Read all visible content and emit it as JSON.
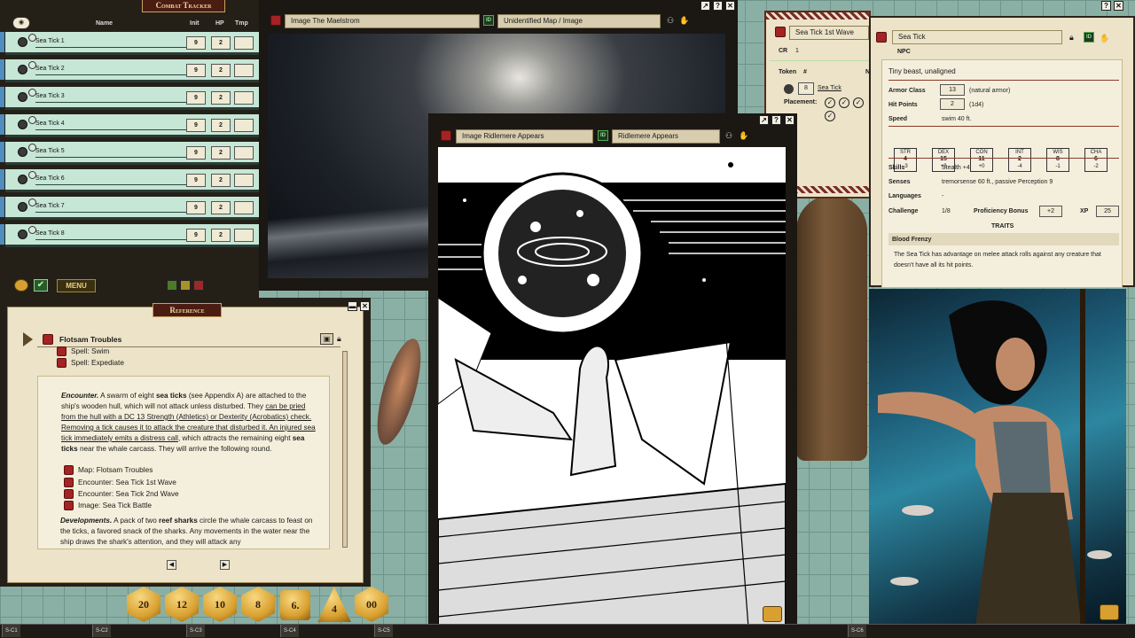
{
  "combat_tracker": {
    "title": "Combat Tracker",
    "col_name": "Name",
    "col_init": "Init",
    "col_hp": "HP",
    "col_tmp": "Tmp",
    "menu_label": "MENU",
    "rows": [
      {
        "name": "Sea Tick 1",
        "init": "9",
        "hp": "2"
      },
      {
        "name": "Sea Tick 2",
        "init": "9",
        "hp": "2"
      },
      {
        "name": "Sea Tick 3",
        "init": "9",
        "hp": "2"
      },
      {
        "name": "Sea Tick 4",
        "init": "9",
        "hp": "2"
      },
      {
        "name": "Sea Tick 5",
        "init": "9",
        "hp": "2"
      },
      {
        "name": "Sea Tick 6",
        "init": "9",
        "hp": "2"
      },
      {
        "name": "Sea Tick 7",
        "init": "9",
        "hp": "2"
      },
      {
        "name": "Sea Tick 8",
        "init": "9",
        "hp": "2"
      }
    ]
  },
  "maelstrom": {
    "title": "Image The Maelstrom",
    "id_label": "ID",
    "id_value": "Unidentified Map / Image"
  },
  "ridlemere": {
    "title": "Image Ridlemere Appears",
    "id_label": "ID",
    "id_value": "Ridlemere Appears"
  },
  "wave1": {
    "title": "Sea Tick 1st Wave",
    "cr_label": "CR",
    "cr_value": "1",
    "token_label": "Token",
    "hash_label": "#",
    "n_label": "N",
    "count": "8",
    "creature": "Sea Tick",
    "placement_label": "Placement:"
  },
  "npc": {
    "name": "Sea Tick",
    "type_label": "NPC",
    "id_label": "ID",
    "subtitle": "Tiny beast, unaligned",
    "ac_label": "Armor Class",
    "ac": "13",
    "ac_note": "(natural armor)",
    "hp_label": "Hit Points",
    "hp": "2",
    "hp_note": "(1d4)",
    "speed_label": "Speed",
    "speed": "swim 40 ft.",
    "abilities": [
      {
        "name": "STR",
        "score": "4",
        "mod": "-3"
      },
      {
        "name": "DEX",
        "score": "15",
        "mod": "+2"
      },
      {
        "name": "CON",
        "score": "11",
        "mod": "+0"
      },
      {
        "name": "INT",
        "score": "2",
        "mod": "-4"
      },
      {
        "name": "WIS",
        "score": "8",
        "mod": "-1"
      },
      {
        "name": "CHA",
        "score": "6",
        "mod": "-2"
      }
    ],
    "skills_label": "Skills",
    "skills": "Stealth +4",
    "senses_label": "Senses",
    "senses": "tremorsense 60 ft., passive Perception 9",
    "languages_label": "Languages",
    "languages": "-",
    "challenge_label": "Challenge",
    "challenge": "1/8",
    "pb_label": "Proficiency Bonus",
    "pb": "+2",
    "xp_label": "XP",
    "xp": "25",
    "traits_header": "TRAITS",
    "trait_name": "Blood Frenzy",
    "trait_text": "The Sea Tick has advantage on melee attack rolls against any creature that doesn't have all its hit points."
  },
  "reference": {
    "title": "Reference",
    "entry_title": "Flotsam Troubles",
    "spells": [
      "Spell: Swim",
      "Spell: Expediate"
    ],
    "enc_lead": "Encounter.",
    "enc_p1": " A swarm of eight ",
    "enc_b1": "sea ticks",
    "enc_p2": " (see Appendix A) are attached to the ship's wooden hull, which will not attack unless disturbed. They ",
    "enc_u1": "can be pried from the hull with a DC 13 Strength (Athletics) or Dexterity (Acrobatics) check. Removing a tick causes it to attack the creature that disturbed it. An injured sea tick immediately emits a distress call",
    "enc_p3": ", which attracts the remaining eight ",
    "enc_b2": "sea ticks",
    "enc_p4": " near the whale carcass. They will arrive the following round.",
    "links": [
      "Map: Flotsam Troubles",
      "Encounter: Sea Tick 1st Wave",
      "Encounter: Sea Tick 2nd Wave",
      "Image: Sea Tick Battle"
    ],
    "dev_lead": "Developments.",
    "dev_p1": " A pack of two ",
    "dev_b1": "reef sharks",
    "dev_p2": " circle the whale carcass to feast on the ticks, a favored snack of the sharks. Any movements in the water near the ship draws the shark's attention, and they will attack any"
  },
  "dice": [
    "20",
    "12",
    "10",
    "8",
    "6.",
    "4",
    "00"
  ],
  "bottom_cells": [
    "S-C1",
    "S-C2",
    "S-C3",
    "S-C4",
    "S-C5",
    "S-C6"
  ]
}
